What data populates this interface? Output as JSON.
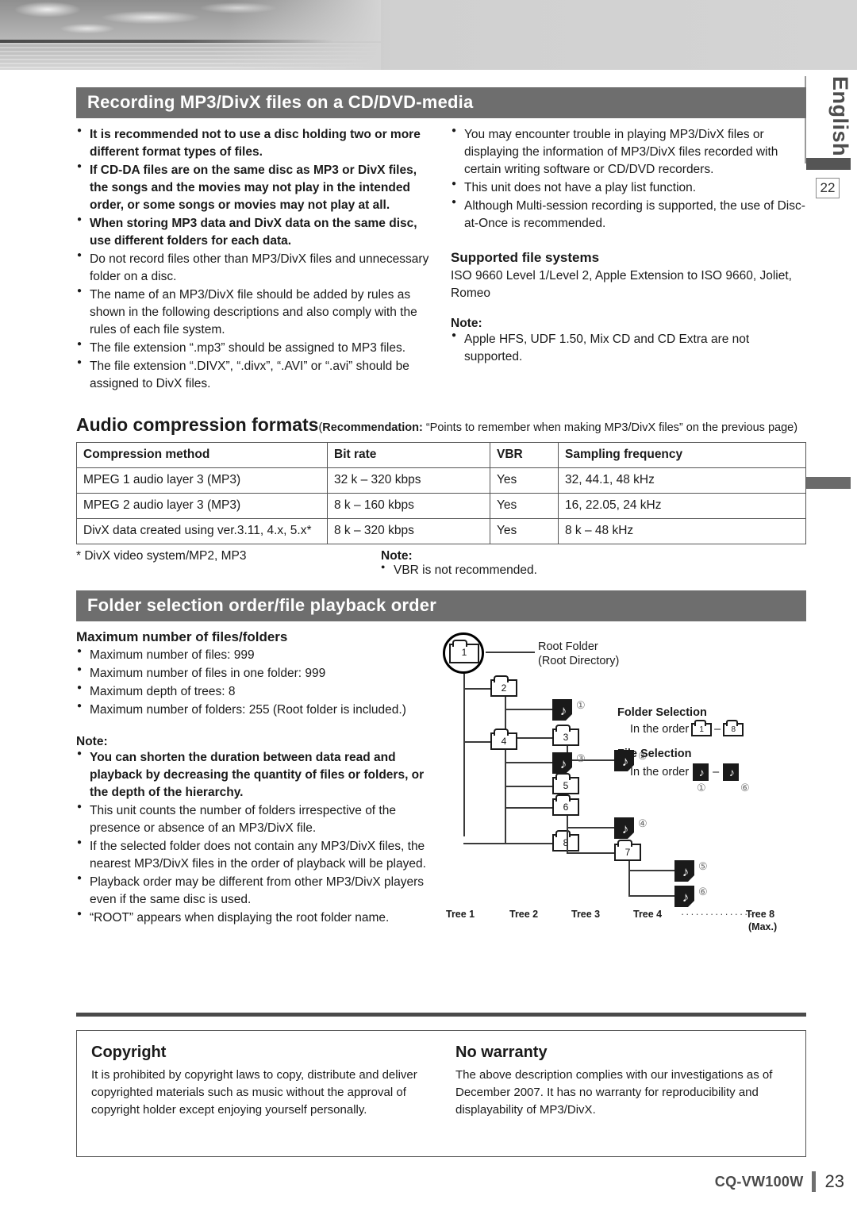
{
  "rail": {
    "language": "English",
    "page_tab": "22"
  },
  "section1": {
    "heading": "Recording MP3/DivX files on a CD/DVD-media",
    "left_bullets": [
      {
        "text": "It is recommended not to use a disc holding two or more different format types of files.",
        "bold": true
      },
      {
        "text": "If CD-DA files are on the same disc as MP3 or DivX files, the songs and the movies may not play in the intended order, or some songs or movies may not play at all.",
        "bold": true
      },
      {
        "text": "When storing MP3 data and DivX data on the same disc, use different folders for each data.",
        "bold": true
      },
      {
        "text": "Do not record files other than MP3/DivX files and unnecessary folder on a disc.",
        "bold": false
      },
      {
        "text": "The name of an MP3/DivX file should be added by rules as shown in the following descriptions and also comply with the rules of each file system.",
        "bold": false
      },
      {
        "text": "The file extension “.mp3” should be assigned to MP3 files.",
        "bold": false
      },
      {
        "text": "The file extension “.DIVX”, “.divx”, “.AVI” or “.avi” should be assigned to DivX files.",
        "bold": false
      }
    ],
    "right_bullets": [
      {
        "text": "You may encounter trouble in playing MP3/DivX files or displaying the information of MP3/DivX files recorded with certain writing software or CD/DVD recorders.",
        "bold": false
      },
      {
        "text": "This unit does not have a play list function.",
        "bold": false
      },
      {
        "text": "Although Multi-session recording is supported, the use of Disc-at-Once is recommended.",
        "bold": false
      }
    ],
    "supported_heading": "Supported file systems",
    "supported_body": "ISO 9660 Level 1/Level 2, Apple Extension to ISO 9660, Joliet, Romeo",
    "note_label": "Note:",
    "note_bullets": [
      "Apple HFS, UDF 1.50, Mix CD and CD Extra are not supported."
    ]
  },
  "audio_formats": {
    "title": "Audio compression formats",
    "recommendation_label": "Recommendation:",
    "recommendation_text": "“Points to remember when making MP3/DivX files” on the previous page)",
    "recommendation_open": "(",
    "columns": [
      "Compression method",
      "Bit rate",
      "VBR",
      "Sampling frequency"
    ],
    "rows": [
      [
        "MPEG 1 audio layer 3 (MP3)",
        "32 k – 320 kbps",
        "Yes",
        "32, 44.1, 48 kHz"
      ],
      [
        "MPEG 2 audio layer 3 (MP3)",
        "8 k – 160 kbps",
        "Yes",
        "16, 22.05, 24 kHz"
      ],
      [
        "DivX data created using ver.3.11, 4.x, 5.x*",
        "8 k – 320 kbps",
        "Yes",
        "8 k – 48 kHz"
      ]
    ],
    "footnote": "* DivX video system/MP2, MP3",
    "note_label": "Note:",
    "note_bullets": [
      "VBR is not recommended."
    ]
  },
  "section2": {
    "heading": "Folder selection order/file playback order",
    "max_heading": "Maximum number of files/folders",
    "max_bullets": [
      "Maximum number of files: 999",
      "Maximum number of files in one folder: 999",
      "Maximum depth of trees: 8",
      "Maximum number of folders: 255 (Root folder is included.)"
    ],
    "note_label": "Note:",
    "note_bullets": [
      {
        "text": "You can shorten the duration between data read and playback by decreasing the quantity of files or folders, or the depth of the hierarchy.",
        "bold": true
      },
      {
        "text": "This unit counts the number of folders irrespective of the presence or absence of an MP3/DivX file.",
        "bold": false
      },
      {
        "text": "If the selected folder does not contain any MP3/DivX files, the nearest MP3/DivX files in the order of playback will be played.",
        "bold": false
      },
      {
        "text": "Playback order may be different from other MP3/DivX players even if the same disc is used.",
        "bold": false
      },
      {
        "text": "“ROOT” appears when displaying the root folder name.",
        "bold": false
      }
    ],
    "diagram": {
      "root_label_line1": "Root Folder",
      "root_label_line2": "(Root Directory)",
      "folders": [
        "1",
        "2",
        "3",
        "4",
        "5",
        "6",
        "7",
        "8"
      ],
      "files": [
        "①",
        "②",
        "③",
        "④",
        "⑤",
        "⑥"
      ],
      "tree_labels": [
        "Tree 1",
        "Tree 2",
        "Tree 3",
        "Tree 4",
        "Tree 8"
      ],
      "tree_dots": "················",
      "tree_max": "(Max.)",
      "folder_selection_heading": "Folder Selection",
      "folder_selection_order": "In the order",
      "folder_selection_from": "1",
      "folder_selection_dash": "–",
      "folder_selection_to": "8",
      "file_selection_heading": "File Selection",
      "file_selection_order": "In the order",
      "file_selection_dash": "–",
      "file_selection_from": "①",
      "file_selection_to": "⑥"
    }
  },
  "legal": {
    "copyright_heading": "Copyright",
    "copyright_body": "It is prohibited by copyright laws to copy, distribute and deliver copyrighted materials such as music without the approval of copyright holder except enjoying yourself personally.",
    "warranty_heading": "No warranty",
    "warranty_body": "The above description complies with our investigations as of December 2007. It has no warranty for reproducibility and displayability of MP3/DivX."
  },
  "footer": {
    "model": "CQ-VW100W",
    "page_number": "23"
  }
}
